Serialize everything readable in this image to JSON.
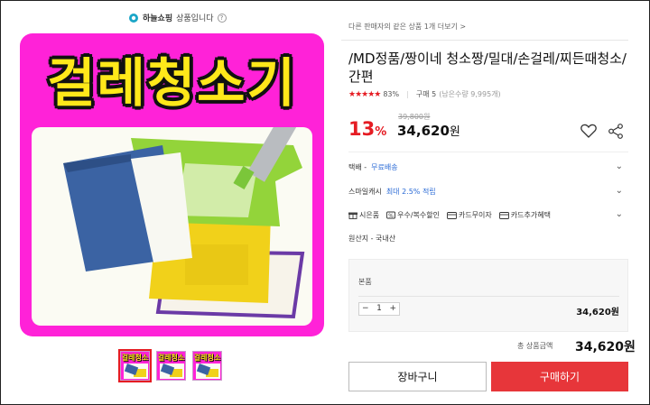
{
  "seller": {
    "name": "하늘쇼핑",
    "suffix": "상품입니다",
    "help": "?"
  },
  "product_image": {
    "title_text": "걸레청소기",
    "thumbnails": [
      {
        "title": "걸레청소기",
        "active": true
      },
      {
        "title": "걸레청소기",
        "active": false
      },
      {
        "title": "걸레청소기",
        "active": false
      }
    ]
  },
  "header": {
    "other_sellers": "다른 판매자의 같은 상품 1개 더보기 >"
  },
  "product": {
    "title": "/MD정품/짱이네 청소짱/밀대/손걸레/찌든때청소/간편",
    "stars": "★★★★★",
    "rating_pct": "83%",
    "buy_count": "구매 5",
    "stock_note": "(남은수량 9,995개)",
    "original_price": "39,800원",
    "discount": "13",
    "discount_unit": "%",
    "price": "34,620",
    "price_unit": "원"
  },
  "info": {
    "delivery_label": "택배 -",
    "delivery_value": "무료배송",
    "smile_label": "스마일캐시",
    "smile_value": "최대 2.5% 적립",
    "benefits": [
      "시은품",
      "우수/복수할인",
      "카드무이자",
      "카드추가혜택"
    ],
    "origin": "원산지 - 국내산"
  },
  "option": {
    "label": "본품",
    "minus": "−",
    "qty": "1",
    "plus": "+",
    "price": "34,620원"
  },
  "total": {
    "label": "총 상품금액",
    "price": "34,620원"
  },
  "actions": {
    "cart_label": "장바구니",
    "buy_label": "구매하기"
  },
  "colors": {
    "accent": "#e51c23",
    "buy_button": "#e7363a",
    "link": "#2b6bd6",
    "image_bg": "#ff22d8",
    "title_yellow": "#ffe81a"
  }
}
